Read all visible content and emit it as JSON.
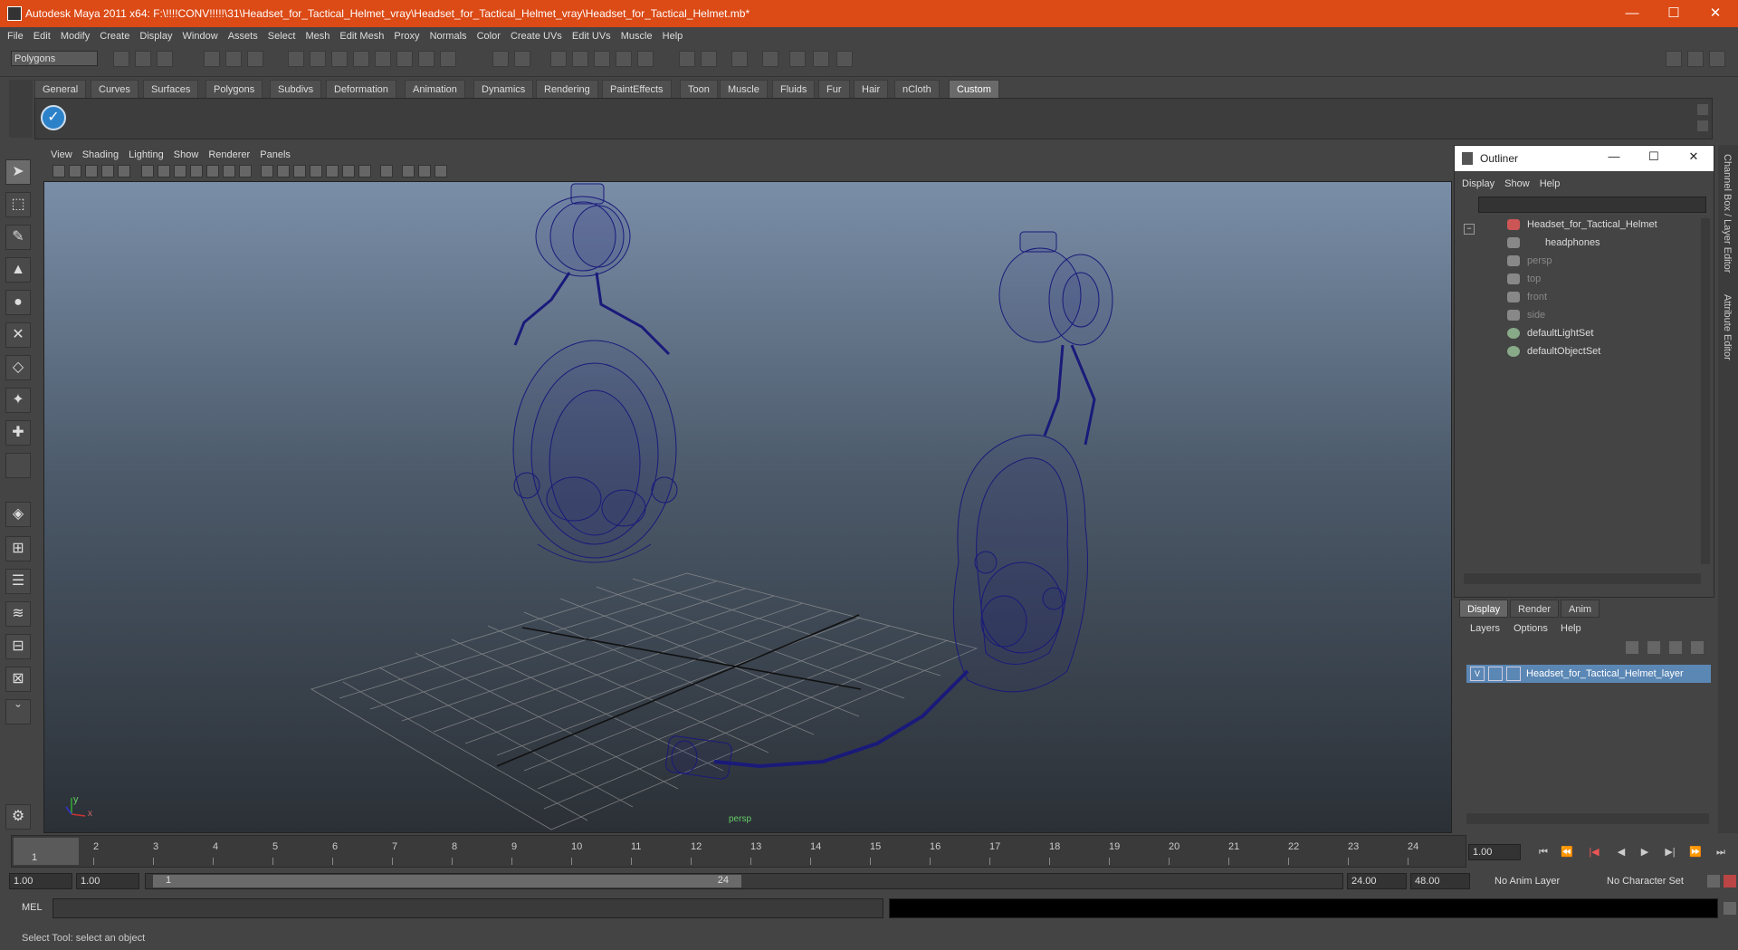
{
  "window": {
    "title": "Autodesk Maya 2011 x64: F:\\!!!!CONV!!!!!\\31\\Headset_for_Tactical_Helmet_vray\\Headset_for_Tactical_Helmet_vray\\Headset_for_Tactical_Helmet.mb*",
    "minimize": "—",
    "maximize": "☐",
    "close": "✕"
  },
  "menubar": [
    "File",
    "Edit",
    "Modify",
    "Create",
    "Display",
    "Window",
    "Assets",
    "Select",
    "Mesh",
    "Edit Mesh",
    "Proxy",
    "Normals",
    "Color",
    "Create UVs",
    "Edit UVs",
    "Muscle",
    "Help"
  ],
  "statusline": {
    "mode": "Polygons"
  },
  "shelf": {
    "tabs": [
      "General",
      "Curves",
      "Surfaces",
      "Polygons",
      "Subdivs",
      "Deformation",
      "Animation",
      "Dynamics",
      "Rendering",
      "PaintEffects",
      "Toon",
      "Muscle",
      "Fluids",
      "Fur",
      "Hair",
      "nCloth",
      "Custom"
    ],
    "active": "Custom"
  },
  "viewport": {
    "menu": [
      "View",
      "Shading",
      "Lighting",
      "Show",
      "Renderer",
      "Panels"
    ],
    "camera_label": "persp",
    "axis_y": "y",
    "axis_x": "x",
    "wire_color": "#1a1a7a"
  },
  "outliner": {
    "title": "Outliner",
    "menu": [
      "Display",
      "Show",
      "Help"
    ],
    "items": [
      {
        "label": "Headset_for_Tactical_Helmet",
        "dim": false
      },
      {
        "label": "headphones",
        "dim": false
      },
      {
        "label": "persp",
        "dim": true
      },
      {
        "label": "top",
        "dim": true
      },
      {
        "label": "front",
        "dim": true
      },
      {
        "label": "side",
        "dim": true
      },
      {
        "label": "defaultLightSet",
        "dim": false
      },
      {
        "label": "defaultObjectSet",
        "dim": false
      }
    ]
  },
  "layer_editor": {
    "tabs": [
      "Display",
      "Render",
      "Anim"
    ],
    "menu": [
      "Layers",
      "Options",
      "Help"
    ],
    "layer_visibility": "V",
    "layer_name": "Headset_for_Tactical_Helmet_layer"
  },
  "timeline": {
    "ticks": [
      "1",
      "2",
      "3",
      "4",
      "5",
      "6",
      "7",
      "8",
      "9",
      "10",
      "11",
      "12",
      "13",
      "14",
      "15",
      "16",
      "17",
      "18",
      "19",
      "20",
      "21",
      "22",
      "23",
      "24"
    ],
    "current_frame_marker": "1",
    "current_time": "1.00"
  },
  "range": {
    "start_time": "1.00",
    "playback_start": "1.00",
    "slider_start": "1",
    "slider_end": "24",
    "playback_end": "24.00",
    "end_time": "48.00",
    "anim_layer": "No Anim Layer",
    "character_set": "No Character Set"
  },
  "cmdline": {
    "label": "MEL"
  },
  "helpline": {
    "text": "Select Tool: select an object"
  },
  "side_tabs": {
    "channel_box": "Channel Box / Layer Editor",
    "attribute_editor": "Attribute Editor"
  }
}
